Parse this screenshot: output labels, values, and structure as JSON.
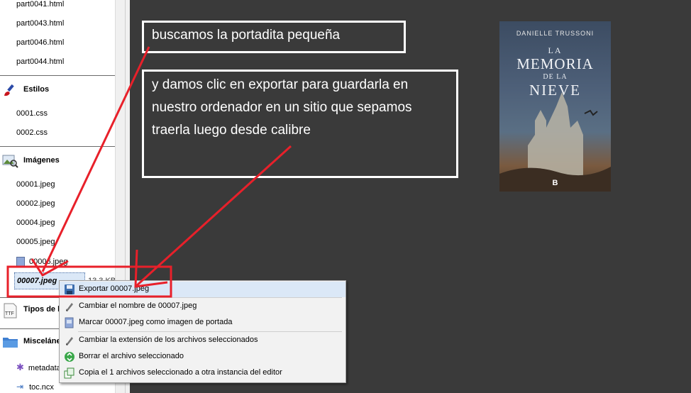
{
  "sidebar": {
    "files_top": [
      "part0041.html",
      "part0043.html",
      "part0046.html",
      "part0044.html"
    ],
    "styles": {
      "header": "Estilos",
      "icon": "brush-icon",
      "files": [
        "0001.css",
        "0002.css"
      ]
    },
    "images": {
      "header": "Imágenes",
      "icon": "image-search-icon",
      "files": [
        "00001.jpeg",
        "00002.jpeg",
        "00004.jpeg",
        "00005.jpeg",
        "00006.jpeg"
      ],
      "selected": "00007.jpeg",
      "selected_size": "13,3 KB"
    },
    "fonts": {
      "header": "Tipos de letra",
      "icon": "ttf-font-icon"
    },
    "misc": {
      "header": "Misceláneo",
      "icon": "folder-icon",
      "files": [
        "metadata.opf",
        "toc.ncx"
      ]
    }
  },
  "annotations": {
    "note1": "buscamos la portadita pequeña",
    "note2": "y damos clic en exportar para guardarla en nuestro ordenador en un sitio que sepamos traerla luego desde calibre",
    "color": "#e8202a"
  },
  "cover": {
    "author": "DANIELLE TRUSSONI",
    "title_la": "LA",
    "title_memoria": "MEMORIA",
    "title_dela": "DE LA",
    "title_nieve": "NIEVE",
    "publisher": "B"
  },
  "context_menu": {
    "items": [
      {
        "label": "Exportar 00007.jpeg",
        "icon": "save-icon"
      },
      {
        "label": "Cambiar el nombre de 00007.jpeg",
        "icon": "rename-pen-icon"
      },
      {
        "label": "Marcar 00007.jpeg como imagen de portada",
        "icon": "image-icon"
      },
      {
        "label": "Cambiar la extensión de los archivos seleccionados",
        "icon": "rename-pen-icon"
      },
      {
        "label": "Borrar el archivo seleccionado",
        "icon": "recycle-icon"
      },
      {
        "label": "Copia el 1 archivos seleccionado a otra instancia del editor",
        "icon": "copy-icon"
      }
    ]
  }
}
